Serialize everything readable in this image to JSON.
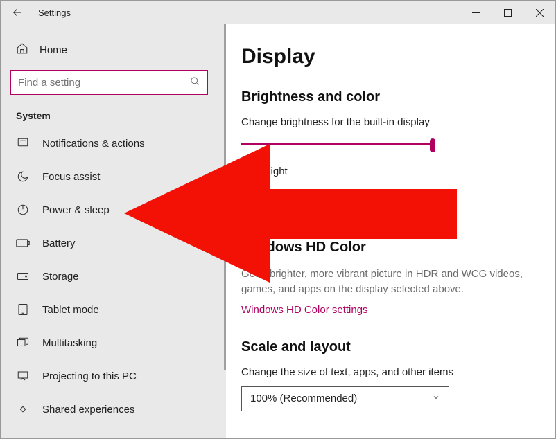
{
  "titlebar": {
    "title": "Settings"
  },
  "sidebar": {
    "home": "Home",
    "search_placeholder": "Find a setting",
    "group": "System",
    "items": [
      {
        "label": "Notifications & actions"
      },
      {
        "label": "Focus assist"
      },
      {
        "label": "Power & sleep"
      },
      {
        "label": "Battery"
      },
      {
        "label": "Storage"
      },
      {
        "label": "Tablet mode"
      },
      {
        "label": "Multitasking"
      },
      {
        "label": "Projecting to this PC"
      },
      {
        "label": "Shared experiences"
      }
    ]
  },
  "main": {
    "title": "Display",
    "brightness_heading": "Brightness and color",
    "brightness_label": "Change brightness for the built-in display",
    "night_light_label": "Night light",
    "hd_heading_partial": "Windows HD Color",
    "hd_desc": "Get a brighter, more vibrant picture in HDR and WCG videos, games, and apps on the display selected above.",
    "hd_link": "Windows HD Color settings",
    "scale_heading": "Scale and layout",
    "scale_label": "Change the size of text, apps, and other items",
    "scale_value": "100% (Recommended)"
  }
}
